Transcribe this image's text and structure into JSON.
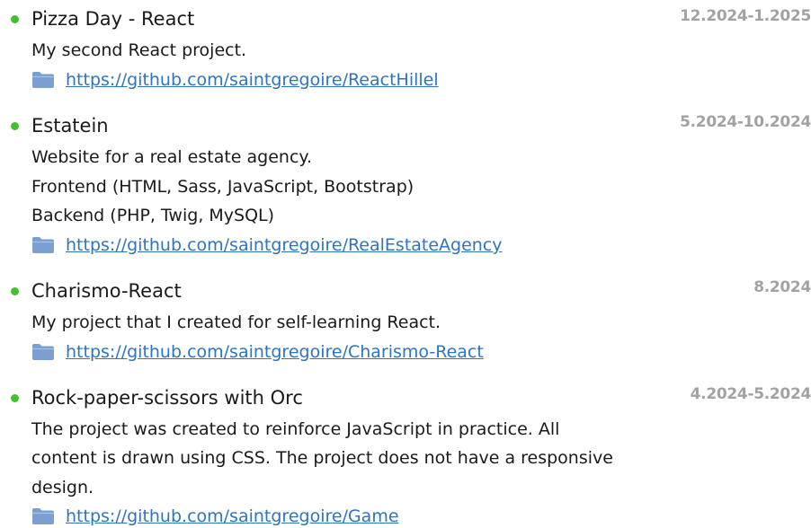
{
  "projects": [
    {
      "title": "Pizza Day - React",
      "date": "12.2024-1.2025",
      "description": [
        "My second React project."
      ],
      "link": "https://github.com/saintgregoire/ReactHillel"
    },
    {
      "title": "Estatein",
      "date": "5.2024-10.2024",
      "description": [
        "Website for a real estate agency.",
        "Frontend (HTML, Sass, JavaScript, Bootstrap)",
        "Backend (PHP, Twig, MySQL)"
      ],
      "link": "https://github.com/saintgregoire/RealEstateAgency"
    },
    {
      "title": "Charismo-React",
      "date": "8.2024",
      "description": [
        "My project that I created for self-learning React."
      ],
      "link": "https://github.com/saintgregoire/Charismo-React"
    },
    {
      "title": "Rock-paper-scissors with Orc",
      "date": "4.2024-5.2024",
      "description": [
        "The project was created to reinforce JavaScript in practice. All",
        "content is drawn using CSS. The project does not have a responsive",
        "design."
      ],
      "link": "https://github.com/saintgregoire/Game"
    }
  ],
  "colors": {
    "bullet": "#44c02e",
    "link": "#2f74c0",
    "date": "#a2a2a2",
    "folder": "#7a9fd0"
  },
  "icons": {
    "bullet": "green-dot-icon",
    "link": "folder-icon"
  }
}
